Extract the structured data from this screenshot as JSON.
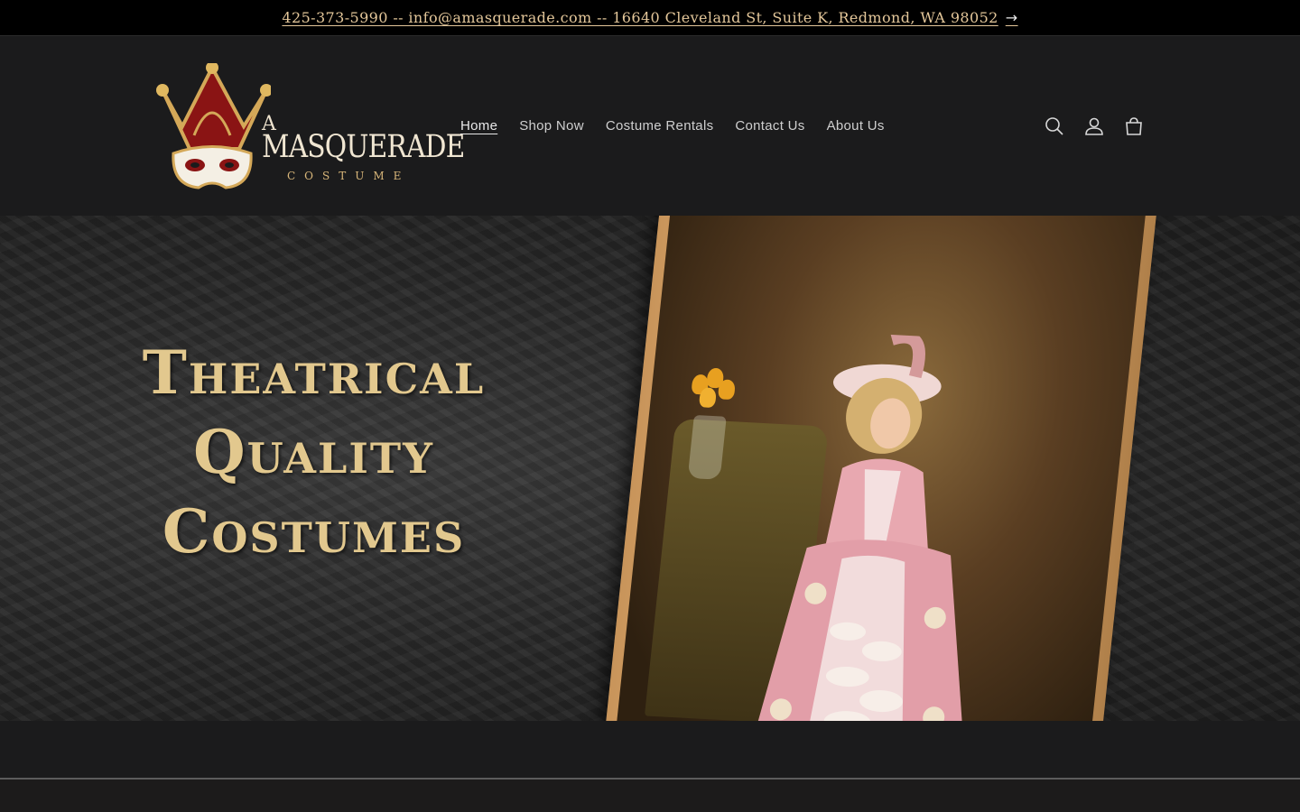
{
  "announcement": {
    "text": "425-373-5990 -- info@amasquerade.com -- 16640 Cleveland St, Suite K, Redmond, WA 98052",
    "arrow": "→"
  },
  "logo": {
    "line1": "A",
    "line2": "MASQUERADE",
    "line3": "COSTUME",
    "icon": "jester-crown-mask-logo"
  },
  "nav": {
    "items": [
      {
        "label": "Home",
        "active": true
      },
      {
        "label": "Shop Now",
        "active": false
      },
      {
        "label": "Costume Rentals",
        "active": false
      },
      {
        "label": "Contact Us",
        "active": false
      },
      {
        "label": "About Us",
        "active": false
      }
    ]
  },
  "header_icons": [
    "search-icon",
    "account-icon",
    "cart-icon"
  ],
  "hero": {
    "title_lines": [
      "Theatrical",
      "Quality",
      "Costumes"
    ],
    "image": "woman-in-pink-rococo-gown-framed-portrait"
  },
  "colors": {
    "announcement_bg": "#000000",
    "announcement_text": "#e4c79a",
    "header_bg": "#1b1b1c",
    "hero_title": "#e2c88e",
    "frame_gold": "#f0c88a"
  }
}
